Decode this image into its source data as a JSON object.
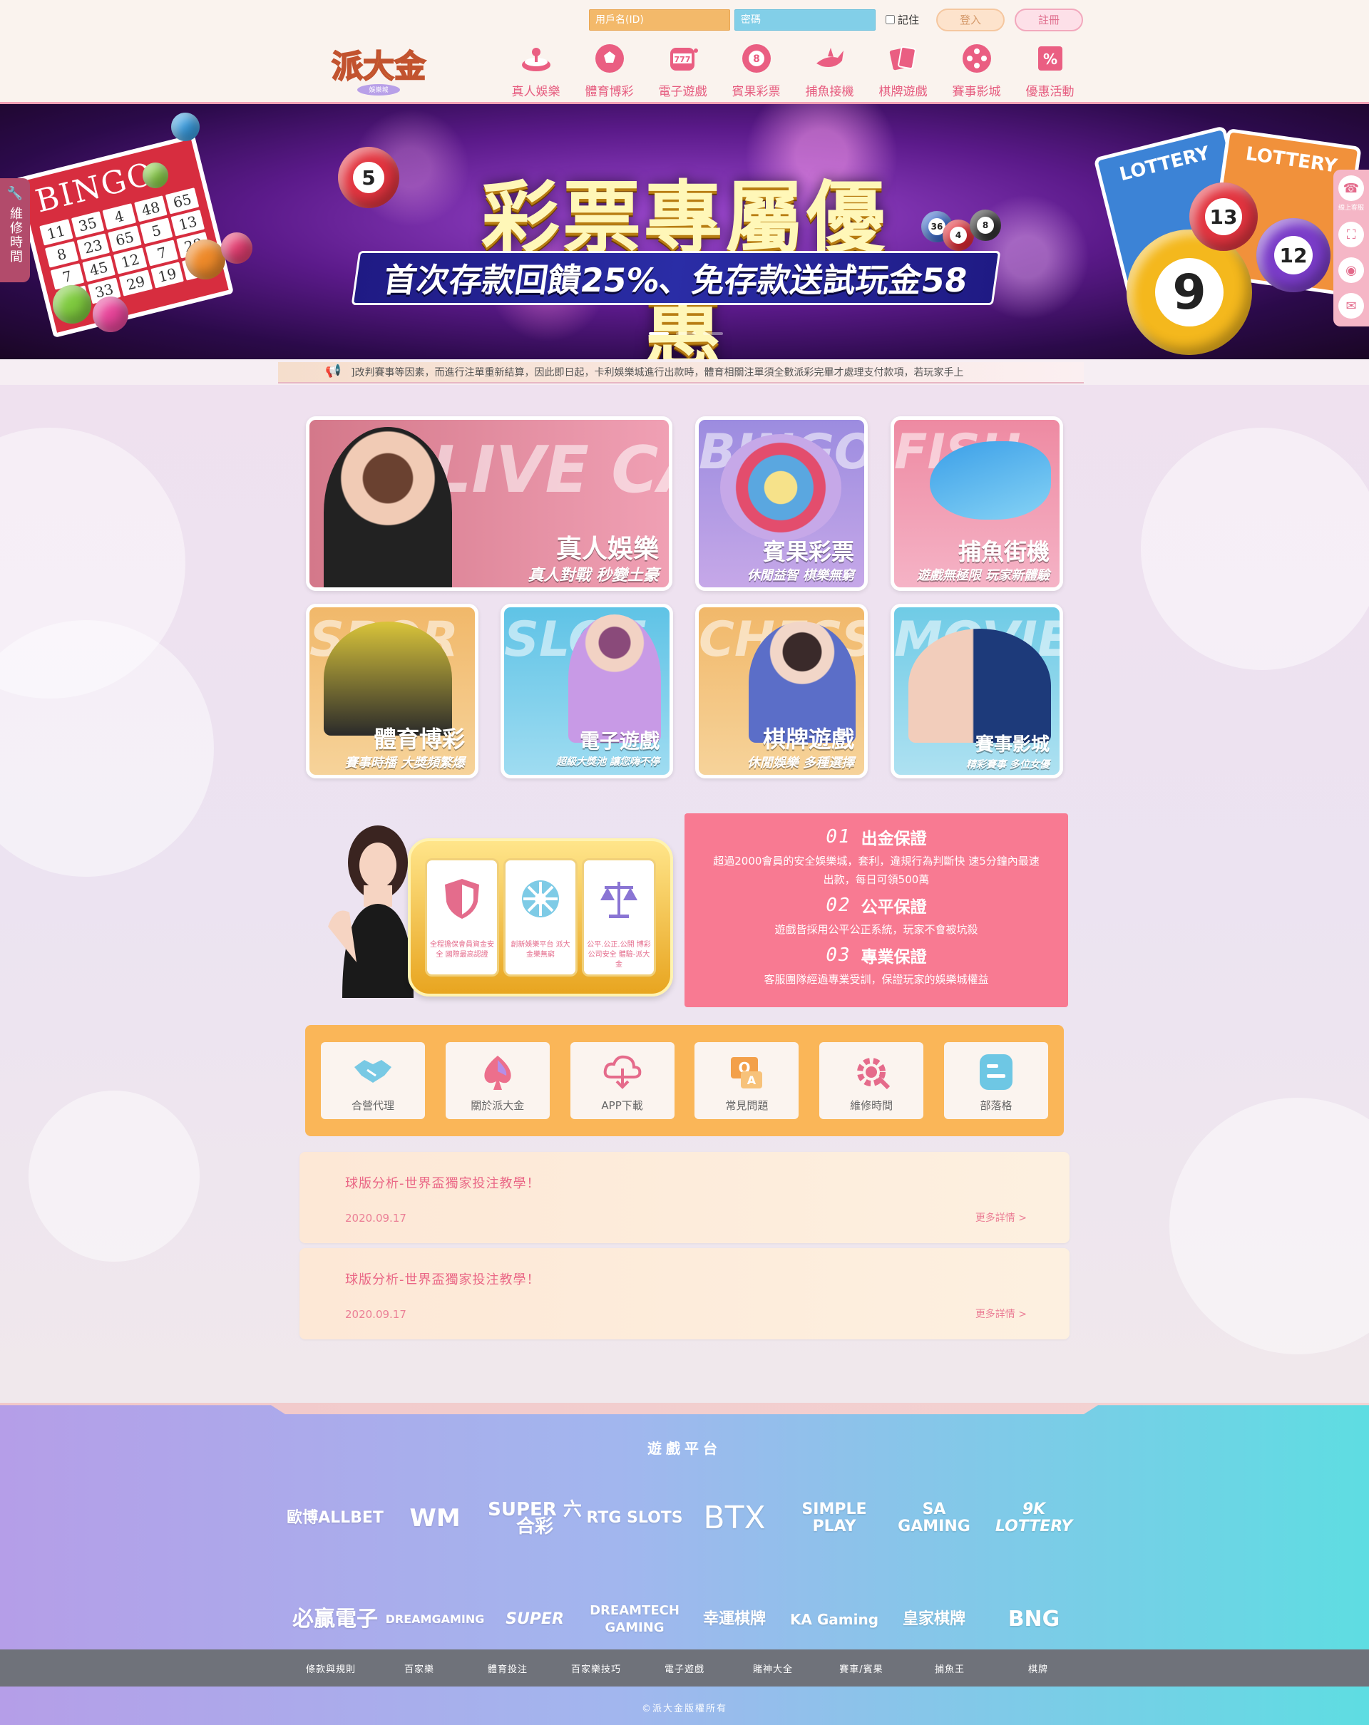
{
  "login": {
    "username_placeholder": "用戶名(ID)",
    "password_placeholder": "密碼",
    "remember_label": "記住",
    "login_label": "登入",
    "register_label": "註冊"
  },
  "logo": {
    "text": "派大金",
    "sub": "娛樂城"
  },
  "nav": [
    {
      "label": "真人娛樂",
      "icon": "roulette-icon"
    },
    {
      "label": "體育博彩",
      "icon": "soccer-ball-icon"
    },
    {
      "label": "電子遊戲",
      "icon": "slot-machine-icon"
    },
    {
      "label": "賓果彩票",
      "icon": "lottery-ball-icon"
    },
    {
      "label": "捕魚接機",
      "icon": "shark-icon"
    },
    {
      "label": "棋牌遊戲",
      "icon": "playing-cards-icon"
    },
    {
      "label": "賽事影城",
      "icon": "film-reel-icon"
    },
    {
      "label": "優惠活動",
      "icon": "discount-icon"
    }
  ],
  "banner": {
    "title": "彩票專屬優惠",
    "subtitle": "首次存款回饋25%、免存款送試玩金58",
    "bingo_label": "BINGO",
    "lottery_label": "LOTTERY",
    "slides": 3,
    "active_slide": 1
  },
  "side_left": {
    "label": "維修時間",
    "icon": "wrench-icon"
  },
  "side_right": {
    "service_label": "線上客服"
  },
  "marquee": {
    "text": "]改判賽事等因素，而進行注單重新結算，因此即日起，卡利娛樂城進行出款時，體育相關注單須全數派彩完畢才處理支付款項，若玩家手上"
  },
  "tiles": [
    {
      "bg_word": "LIVE CASINO",
      "title": "真人娛樂",
      "sub": "真人對戰 秒變土豪"
    },
    {
      "bg_word": "BINGO",
      "title": "賓果彩票",
      "sub": "休閒益智 棋樂無窮"
    },
    {
      "bg_word": "FISH",
      "title": "捕魚街機",
      "sub": "遊戲無極限 玩家新體驗"
    },
    {
      "bg_word": "SPOR",
      "title": "體育博彩",
      "sub": "賽事時播 大獎頻繁爆"
    },
    {
      "bg_word": "SLOT",
      "title": "電子遊戲",
      "sub": "超級大獎池 讓您嗨不停"
    },
    {
      "bg_word": "CHESS",
      "title": "棋牌遊戲",
      "sub": "休閒娛樂 多種選擇"
    },
    {
      "bg_word": "MOVIE",
      "title": "賽事影城",
      "sub": "精彩賽事 多位女優"
    }
  ],
  "reels": [
    {
      "icon": "shield-icon",
      "text": "全程擔保會員資金安全 國際最高認證"
    },
    {
      "icon": "wheel-icon",
      "text": "創新娛樂平台 派大金樂無窮"
    },
    {
      "icon": "scale-icon",
      "text": "公平.公正.公開 博彩公司安全 體驗-派大金"
    }
  ],
  "guarantees": [
    {
      "num": "01",
      "title": "出金保證",
      "desc": "超過2000會員的安全娛樂城，套利，違規行為判斷快 速5分鐘內最速出款，每日可領500萬"
    },
    {
      "num": "02",
      "title": "公平保證",
      "desc": "遊戲皆採用公平公正系統，玩家不會被坑殺"
    },
    {
      "num": "03",
      "title": "專業保證",
      "desc": "客服團隊經過專業受訓，保證玩家的娛樂城權益"
    }
  ],
  "shortcuts": [
    {
      "label": "合營代理",
      "icon": "handshake-icon",
      "color": "#78c9e4"
    },
    {
      "label": "關於派大金",
      "icon": "spade-icon",
      "color": "#ec6f8c"
    },
    {
      "label": "APP下載",
      "icon": "cloud-download-icon",
      "color": "#e56b8b"
    },
    {
      "label": "常見問題",
      "icon": "qa-icon",
      "color": "#f3a04a"
    },
    {
      "label": "維修時間",
      "icon": "gear-icon",
      "color": "#e56b8b"
    },
    {
      "label": "部落格",
      "icon": "blog-icon",
      "color": "#6ec7e4"
    }
  ],
  "news": [
    {
      "title": "球版分析-世界盃獨家投注教學！",
      "date": "2020.09.17",
      "more": "更多詳情 >"
    },
    {
      "title": "球版分析-世界盃獨家投注教學！",
      "date": "2020.09.17",
      "more": "更多詳情 >"
    }
  ],
  "footer": {
    "title": "遊戲平台",
    "platforms": [
      "歐博ALLBET",
      "WM",
      "SUPER 六合彩",
      "RTG SLOTS",
      "BTX",
      "SIMPLE PLAY",
      "SA GAMING",
      "9K LOTTERY",
      "必贏電子",
      "DREAMGAMING",
      "SUPER",
      "DREAMTECH GAMING",
      "幸運棋牌",
      "KA Gaming",
      "皇家棋牌",
      "BNG"
    ],
    "links": [
      "條款與規則",
      "百家樂",
      "體育投注",
      "百家樂技巧",
      "電子遊戲",
      "賭神大全",
      "賽車/賓果",
      "捕魚王",
      "棋牌"
    ],
    "copyright": "©派大金版權所有"
  },
  "colors": {
    "accent": "#ea5e82",
    "gold": "#fab658",
    "guarantee": "#f87a92"
  }
}
